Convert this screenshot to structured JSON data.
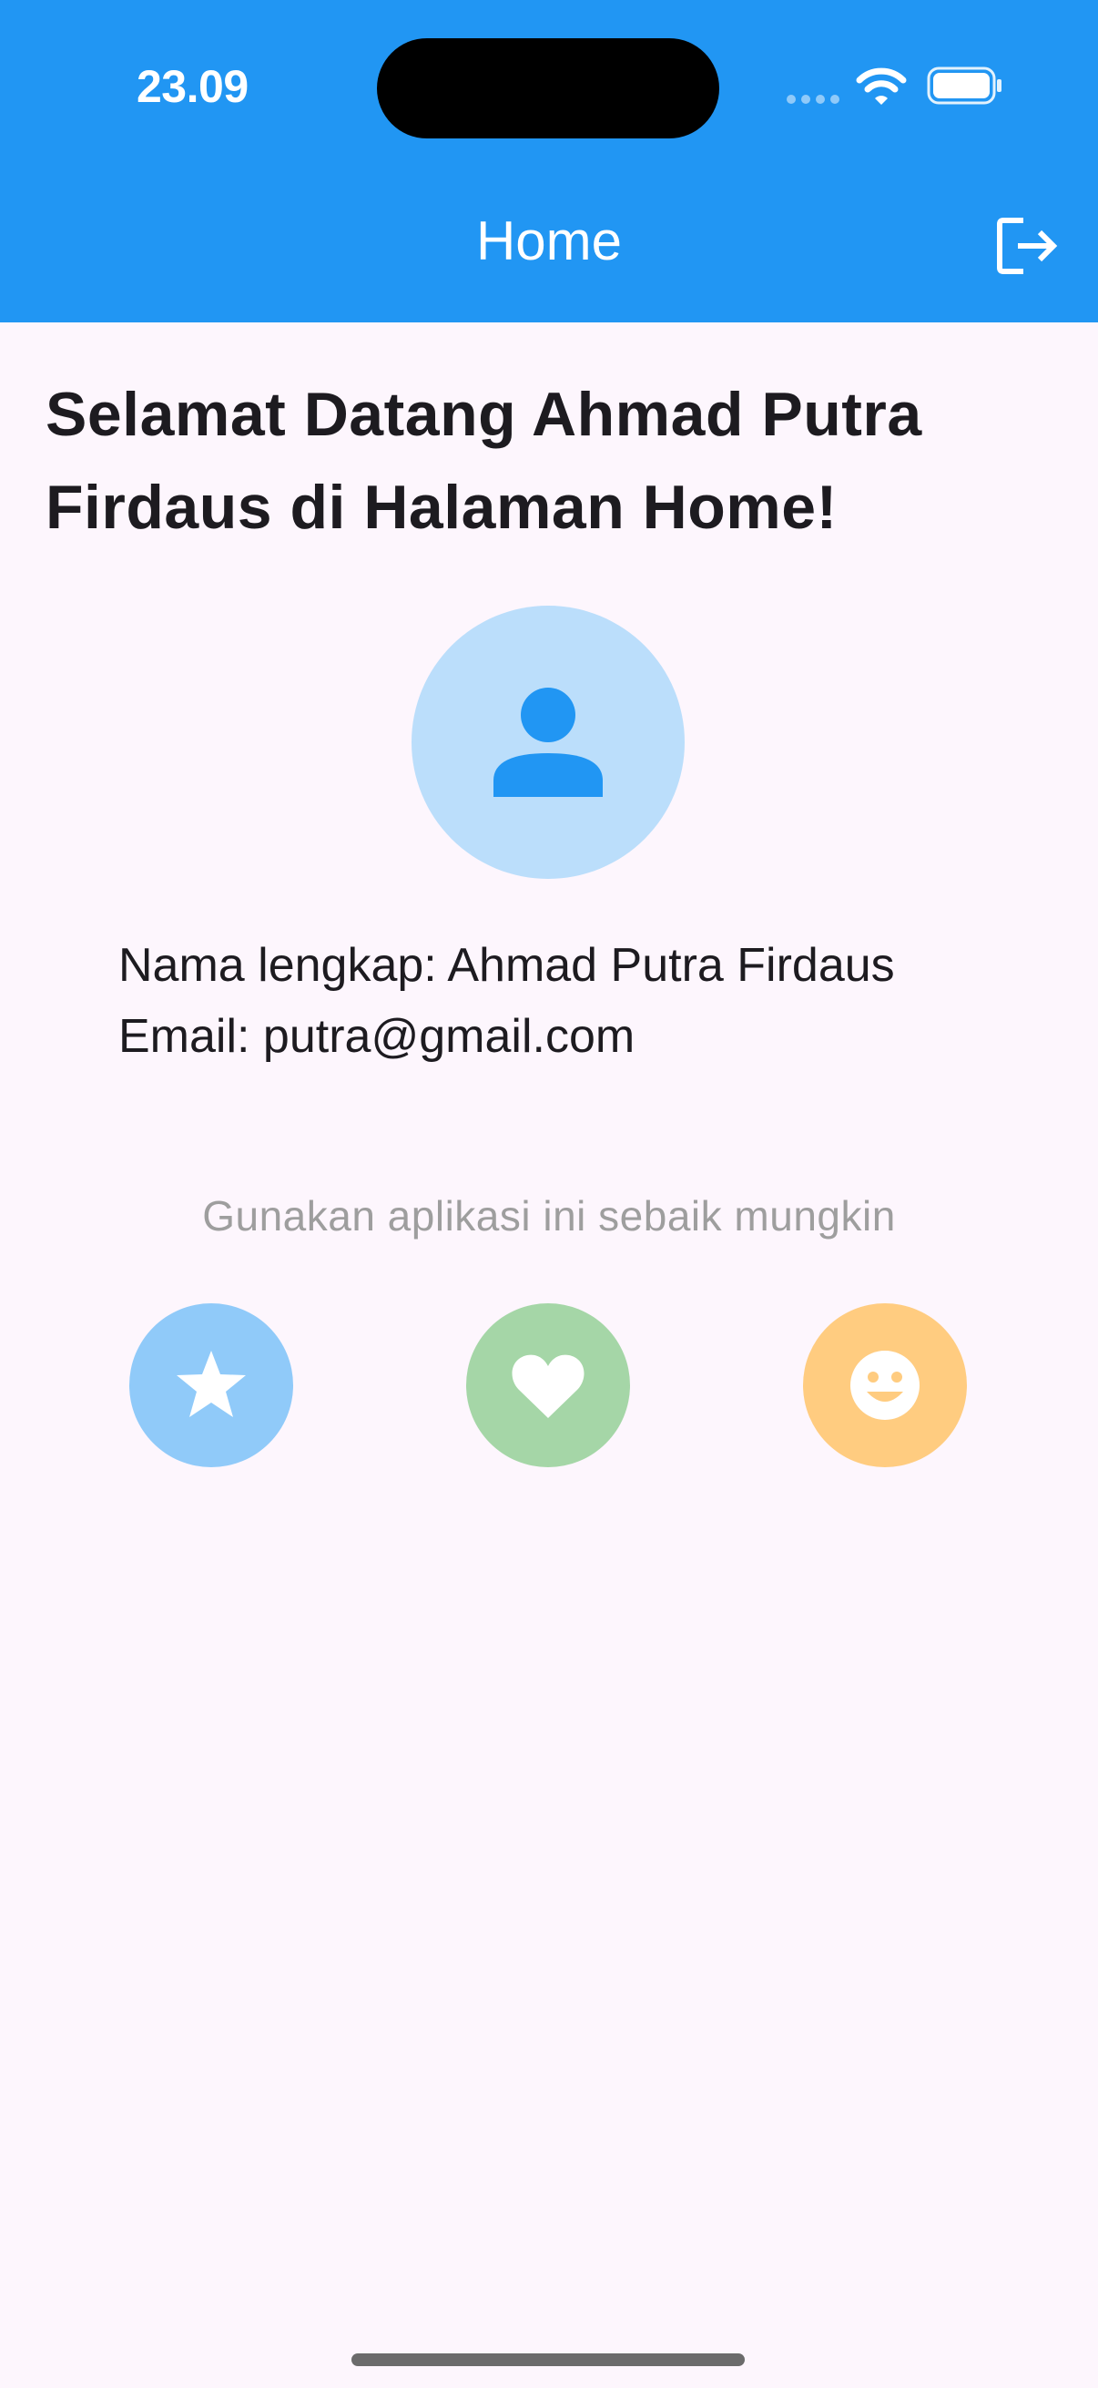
{
  "status_bar": {
    "time": "23.09"
  },
  "app_bar": {
    "title": "Home",
    "logout_icon": "logout-icon"
  },
  "main": {
    "welcome": "Selamat Datang Ahmad Putra Firdaus di Halaman Home!",
    "avatar_icon": "person-icon",
    "full_name_line": "Nama lengkap: Ahmad Putra Firdaus",
    "email_line": "Email: putra@gmail.com",
    "subtitle": "Gunakan aplikasi ini sebaik mungkin",
    "action_buttons": [
      {
        "icon": "star-icon",
        "color": "#90caf9"
      },
      {
        "icon": "heart-icon",
        "color": "#a5d6a7"
      },
      {
        "icon": "smile-icon",
        "color": "#ffcc80"
      }
    ]
  },
  "colors": {
    "primary": "#2196f3",
    "background": "#fdf6fd",
    "avatar_bg": "#bbdefb"
  }
}
